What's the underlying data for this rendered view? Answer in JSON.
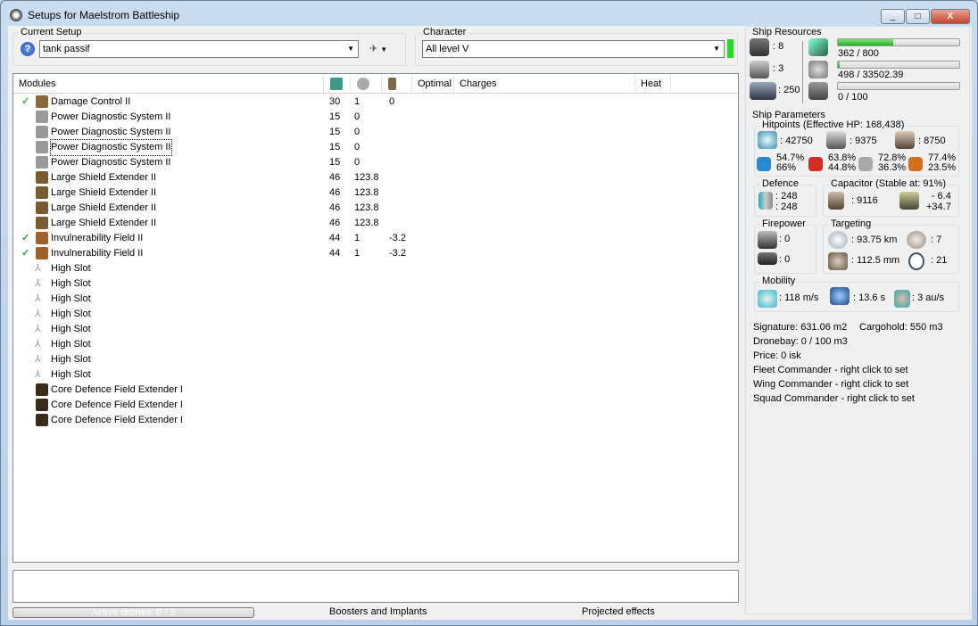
{
  "window": {
    "title": "Setups for Maelstrom Battleship",
    "buttons": [
      "_",
      "□",
      "X"
    ]
  },
  "setup": {
    "label": "Current Setup",
    "value": "tank passif",
    "help_icon": "question-icon",
    "drone_icon": "drone-icon"
  },
  "character": {
    "label": "Character",
    "value": "All level V",
    "status_color": "#22dd22"
  },
  "modules": {
    "headers": [
      "Modules",
      "",
      "",
      "",
      "Optimal",
      "Charges",
      "Heat"
    ],
    "header_icons": [
      "cpu-icon",
      "powergrid-icon",
      "capacitor-icon"
    ],
    "rows": [
      {
        "checked": true,
        "name": "Damage Control II",
        "cpu": "30",
        "pg": "1",
        "cap": "0",
        "icon": "#8a6a3a"
      },
      {
        "checked": false,
        "name": "Power Diagnostic System II",
        "cpu": "15",
        "pg": "0",
        "cap": "",
        "icon": "#999"
      },
      {
        "checked": false,
        "name": "Power Diagnostic System II",
        "cpu": "15",
        "pg": "0",
        "cap": "",
        "icon": "#999"
      },
      {
        "checked": false,
        "name": "Power Diagnostic System II",
        "cpu": "15",
        "pg": "0",
        "cap": "",
        "icon": "#999",
        "focused": true
      },
      {
        "checked": false,
        "name": "Power Diagnostic System II",
        "cpu": "15",
        "pg": "0",
        "cap": "",
        "icon": "#999"
      },
      {
        "checked": false,
        "name": "Large Shield Extender II",
        "cpu": "46",
        "pg": "123.8",
        "cap": "",
        "icon": "#7a5a30"
      },
      {
        "checked": false,
        "name": "Large Shield Extender II",
        "cpu": "46",
        "pg": "123.8",
        "cap": "",
        "icon": "#7a5a30"
      },
      {
        "checked": false,
        "name": "Large Shield Extender II",
        "cpu": "46",
        "pg": "123.8",
        "cap": "",
        "icon": "#7a5a30"
      },
      {
        "checked": false,
        "name": "Large Shield Extender II",
        "cpu": "46",
        "pg": "123.8",
        "cap": "",
        "icon": "#7a5a30"
      },
      {
        "checked": true,
        "name": "Invulnerability Field II",
        "cpu": "44",
        "pg": "1",
        "cap": "-3.2",
        "icon": "#a0602a"
      },
      {
        "checked": true,
        "name": "Invulnerability Field II",
        "cpu": "44",
        "pg": "1",
        "cap": "-3.2",
        "icon": "#a0602a"
      },
      {
        "checked": false,
        "name": "High Slot",
        "cpu": "",
        "pg": "",
        "cap": "",
        "icon": "slot"
      },
      {
        "checked": false,
        "name": "High Slot",
        "cpu": "",
        "pg": "",
        "cap": "",
        "icon": "slot"
      },
      {
        "checked": false,
        "name": "High Slot",
        "cpu": "",
        "pg": "",
        "cap": "",
        "icon": "slot"
      },
      {
        "checked": false,
        "name": "High Slot",
        "cpu": "",
        "pg": "",
        "cap": "",
        "icon": "slot"
      },
      {
        "checked": false,
        "name": "High Slot",
        "cpu": "",
        "pg": "",
        "cap": "",
        "icon": "slot"
      },
      {
        "checked": false,
        "name": "High Slot",
        "cpu": "",
        "pg": "",
        "cap": "",
        "icon": "slot"
      },
      {
        "checked": false,
        "name": "High Slot",
        "cpu": "",
        "pg": "",
        "cap": "",
        "icon": "slot"
      },
      {
        "checked": false,
        "name": "High Slot",
        "cpu": "",
        "pg": "",
        "cap": "",
        "icon": "slot"
      },
      {
        "checked": false,
        "name": "Core Defence Field Extender I",
        "cpu": "",
        "pg": "",
        "cap": "",
        "icon": "#3a2a1a"
      },
      {
        "checked": false,
        "name": "Core Defence Field Extender I",
        "cpu": "",
        "pg": "",
        "cap": "",
        "icon": "#3a2a1a"
      },
      {
        "checked": false,
        "name": "Core Defence Field Extender I",
        "cpu": "",
        "pg": "",
        "cap": "",
        "icon": "#3a2a1a"
      }
    ]
  },
  "bottom": {
    "drones": "Active drones: 0 / 5",
    "boosters": "Boosters and Implants",
    "projected": "Projected effects"
  },
  "resources": {
    "label": "Ship Resources",
    "turrets": ": 8",
    "launchers": ": 3",
    "calibration": ": 250",
    "cpu": {
      "text": "362 / 800",
      "fraction": 0.4525
    },
    "powergrid": {
      "text": "498 / 33502.39",
      "fraction": 0.0149
    },
    "drone_bw": {
      "text": "0 / 100",
      "fraction": 0
    }
  },
  "params": {
    "label": "Ship Parameters",
    "hitpoints": {
      "label": "Hitpoints (Effective HP: 168,438)",
      "shield": ": 42750",
      "armor": ": 9375",
      "structure": ": 8750",
      "resists": [
        {
          "a": "54.7%",
          "b": "66%",
          "color": "#2a8ad0"
        },
        {
          "a": "63.8%",
          "b": "44.8%",
          "color": "#d03020"
        },
        {
          "a": "72.8%",
          "b": "36.3%",
          "color": "#aaa"
        },
        {
          "a": "77.4%",
          "b": "23.5%",
          "color": "#d07020"
        }
      ]
    },
    "defence": {
      "label": "Defence",
      "a": ": 248",
      "b": ": 248"
    },
    "capacitor": {
      "label": "Capacitor (Stable at: 91%)",
      "amount": ": 9116",
      "a": "- 6.4",
      "b": "+34.7"
    },
    "firepower": {
      "label": "Firepower",
      "a": ": 0",
      "b": ": 0"
    },
    "targeting": {
      "label": "Targeting",
      "range": ": 93.75 km",
      "targets": ": 7",
      "resolution": ": 112.5 mm",
      "sensor": ": 21"
    },
    "mobility": {
      "label": "Mobility",
      "speed": ": 118 m/s",
      "align": ": 13.6 s",
      "warp": ": 3 au/s"
    }
  },
  "info": {
    "signature": "Signature: 631.06 m2",
    "cargo": "Cargohold: 550 m3",
    "dronebay": "Dronebay: 0 / 100 m3",
    "price": "Price: 0 isk",
    "fleet": "Fleet Commander - right click to set",
    "wing": "Wing Commander - right click to set",
    "squad": "Squad Commander - right click to set"
  }
}
